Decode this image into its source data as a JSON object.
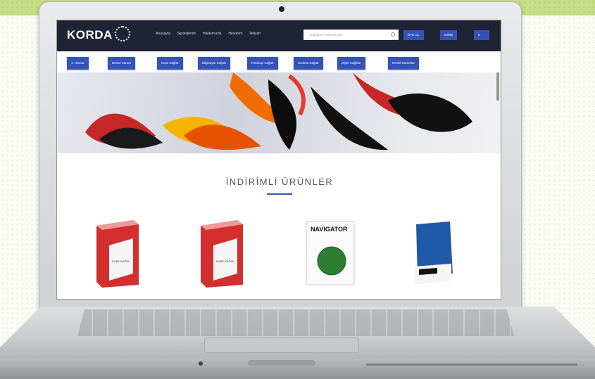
{
  "site": {
    "logo": "KORDA",
    "logo_sub": "",
    "nav": [
      "Anasayfa",
      "Siparişlerim",
      "Hakkımızda",
      "Hesabım",
      "İletişim"
    ],
    "search_placeholder": "Aradığınız kelimeyi girin",
    "top_buttons": [
      "ÜYE OL",
      "GİRİŞ"
    ],
    "cart_count": "0",
    "menu": [
      "1. Hamur",
      "Bristol Karton",
      "Kuşe Kağıdı",
      "Bilgisayar Kağıdı",
      "Fotokopi Kağıdı",
      "Sıvama Kağıdı",
      "Diğer Kağıtlar",
      "Renkli Kartonlar"
    ],
    "section_title": "İNDİRİMLİ ÜRÜNLER",
    "products": [
      {
        "label": "KUŞE KAĞIDI"
      },
      {
        "label": "KUŞE KAĞIDI"
      },
      {
        "label": "NAVIGATOR"
      },
      {
        "label": ""
      }
    ]
  },
  "colors": {
    "header": "#1f2334",
    "accent": "#3353b8"
  }
}
